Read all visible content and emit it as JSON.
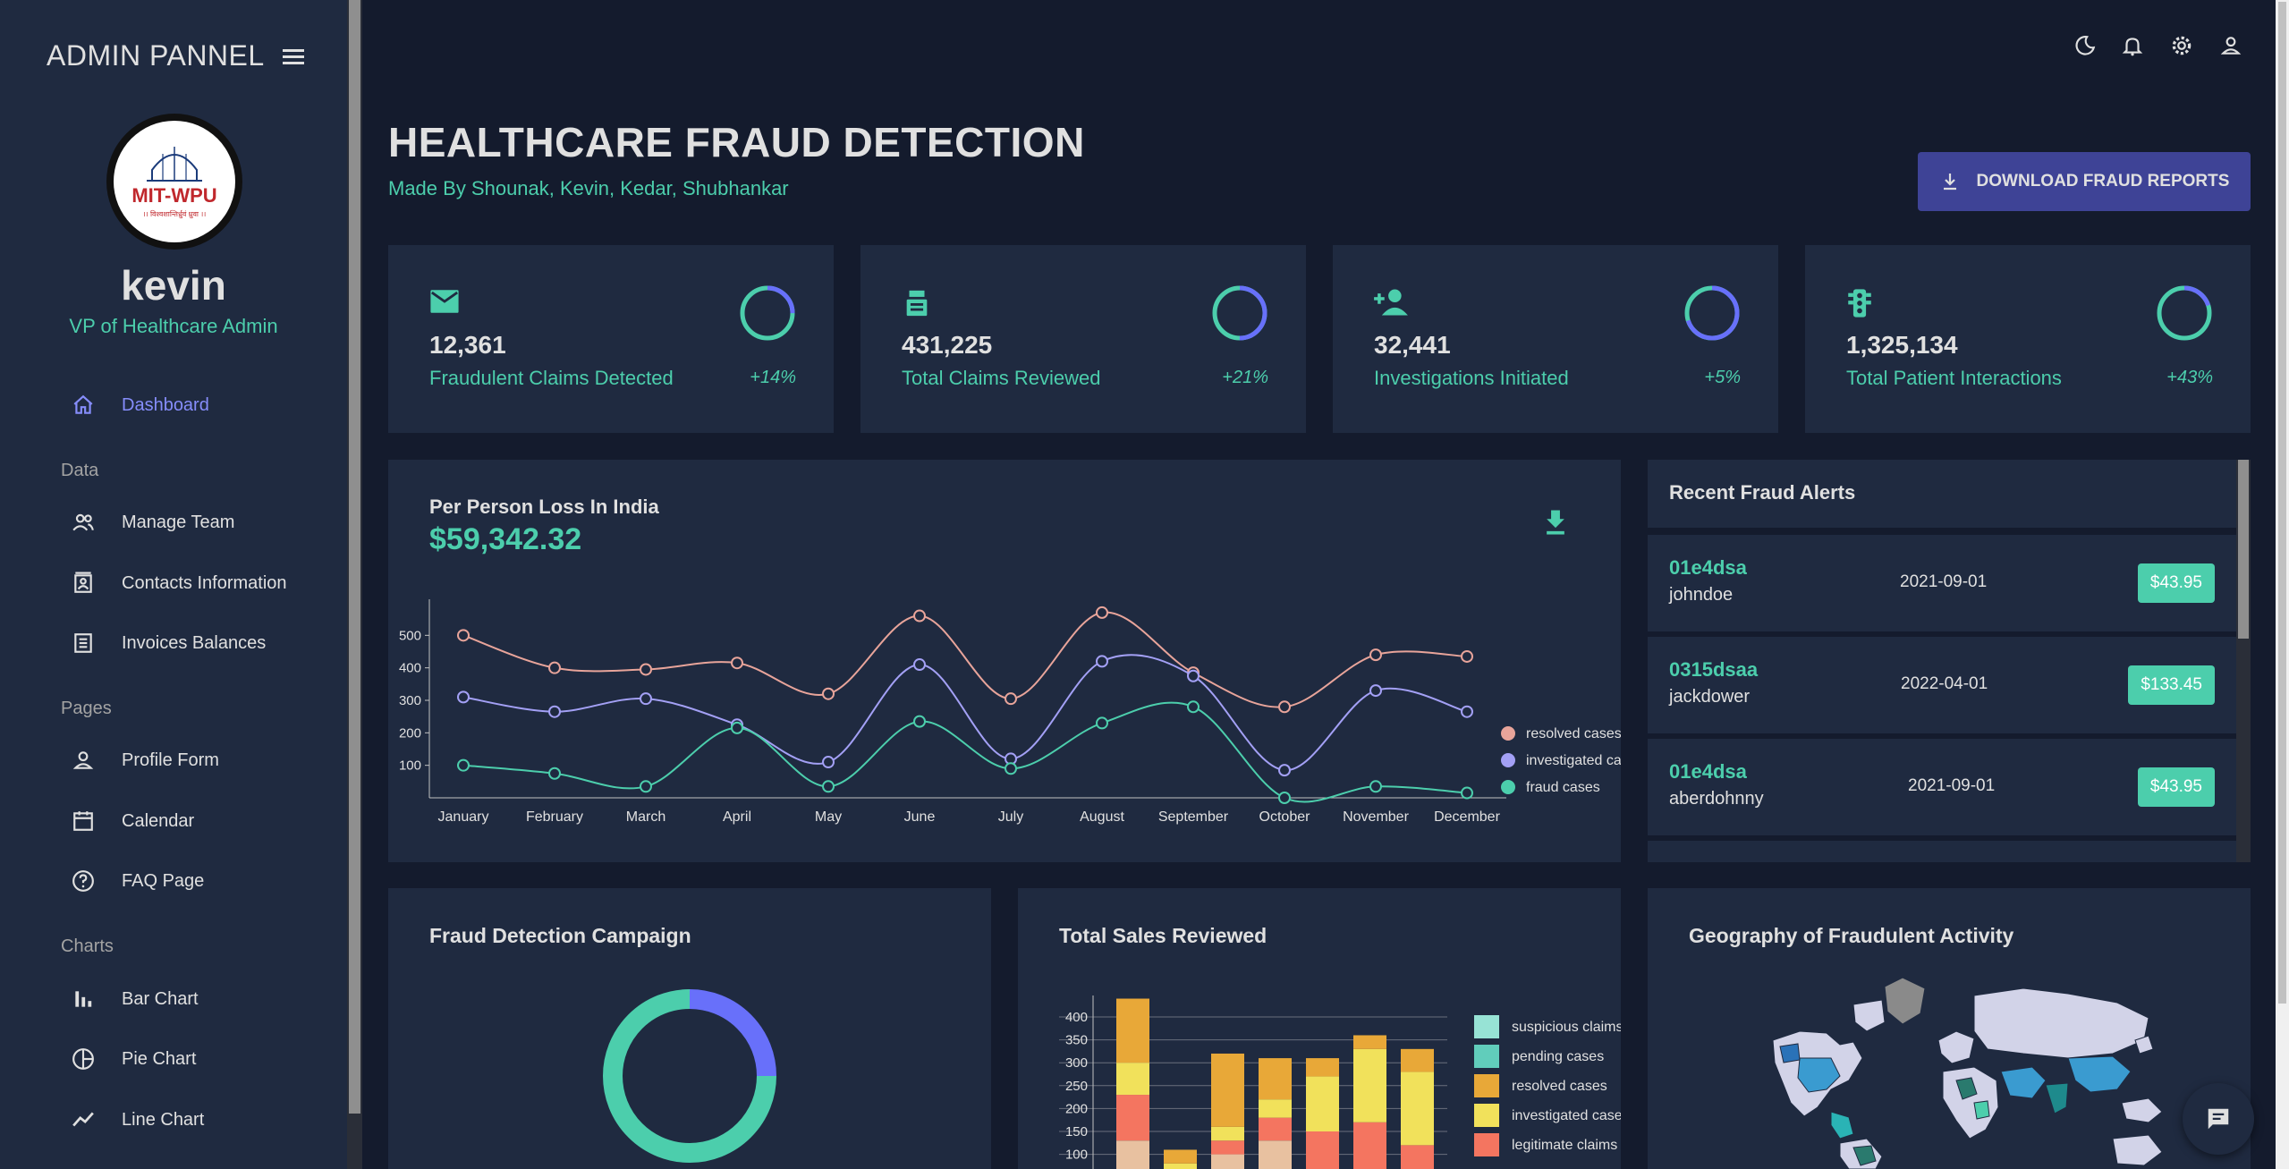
{
  "sidebar": {
    "title": "ADMIN PANNEL",
    "logo_text": "MIT-WPU",
    "logo_sub": "।। विश्वशान्तिर्ध्रुवं ध्रुवा ।।",
    "user_name": "kevin",
    "user_role": "VP of Healthcare Admin",
    "items": [
      {
        "label": "Dashboard",
        "icon": "home-icon"
      },
      {
        "label": "Manage Team",
        "icon": "people-icon"
      },
      {
        "label": "Contacts Information",
        "icon": "contacts-icon"
      },
      {
        "label": "Invoices Balances",
        "icon": "receipt-icon"
      },
      {
        "label": "Profile Form",
        "icon": "person-icon"
      },
      {
        "label": "Calendar",
        "icon": "calendar-icon"
      },
      {
        "label": "FAQ Page",
        "icon": "help-icon"
      },
      {
        "label": "Bar Chart",
        "icon": "bar-chart-icon"
      },
      {
        "label": "Pie Chart",
        "icon": "pie-chart-icon"
      },
      {
        "label": "Line Chart",
        "icon": "line-chart-icon"
      }
    ],
    "sections": [
      "Data",
      "Pages",
      "Charts"
    ]
  },
  "header": {
    "title": "HEALTHCARE FRAUD DETECTION",
    "subtitle": "Made By Shounak, Kevin, Kedar, Shubhankar",
    "download_label": "DOWNLOAD FRAUD REPORTS"
  },
  "stats": [
    {
      "value": "12,361",
      "label": "Fraudulent Claims Detected",
      "increase": "+14%",
      "progress": 0.75,
      "icon": "email-icon"
    },
    {
      "value": "431,225",
      "label": "Total Claims Reviewed",
      "increase": "+21%",
      "progress": 0.5,
      "icon": "point-of-sale-icon"
    },
    {
      "value": "32,441",
      "label": "Investigations Initiated",
      "increase": "+5%",
      "progress": 0.3,
      "icon": "person-add-icon"
    },
    {
      "value": "1,325,134",
      "label": "Total Patient Interactions",
      "increase": "+43%",
      "progress": 0.8,
      "icon": "traffic-icon"
    }
  ],
  "line_panel": {
    "title": "Per Person Loss In India",
    "value": "$59,342.32"
  },
  "alerts": {
    "title": "Recent Fraud Alerts",
    "rows": [
      {
        "txId": "01e4dsa",
        "user": "johndoe",
        "date": "2021-09-01",
        "cost": "$43.95"
      },
      {
        "txId": "0315dsaa",
        "user": "jackdower",
        "date": "2022-04-01",
        "cost": "$133.45"
      },
      {
        "txId": "01e4dsa",
        "user": "aberdohnny",
        "date": "2021-09-01",
        "cost": "$43.95"
      }
    ]
  },
  "panels": {
    "campaign_title": "Fraud Detection Campaign",
    "sales_title": "Total Sales Reviewed",
    "geo_title": "Geography of Fraudulent Activity"
  },
  "colors": {
    "accent": "#4cceac",
    "primary_btn": "#3e4396",
    "active_nav": "#868dfb",
    "card": "#1f2a40",
    "background": "#141b2d"
  },
  "chart_data": [
    {
      "type": "line",
      "x": [
        "January",
        "February",
        "March",
        "April",
        "May",
        "June",
        "July",
        "August",
        "September",
        "October",
        "November",
        "December"
      ],
      "ylim": [
        0,
        600
      ],
      "yticks": [
        100,
        200,
        300,
        400,
        500
      ],
      "series": [
        {
          "name": "resolved cases",
          "color": "#e8a49a",
          "values": [
            500,
            400,
            395,
            415,
            320,
            560,
            305,
            570,
            385,
            280,
            440,
            435
          ]
        },
        {
          "name": "investigated cases",
          "color": "#a3a0f5",
          "values": [
            310,
            265,
            305,
            225,
            110,
            410,
            120,
            420,
            375,
            85,
            330,
            265
          ]
        },
        {
          "name": "fraud cases",
          "color": "#4cceac",
          "values": [
            100,
            75,
            35,
            215,
            35,
            235,
            90,
            230,
            280,
            0,
            35,
            15
          ]
        }
      ],
      "legend": "right"
    },
    {
      "type": "pie",
      "values": [
        0.25,
        0.75
      ],
      "colors": [
        "#6870fa",
        "#4cceac"
      ]
    },
    {
      "type": "bar",
      "stacked": true,
      "yticks": [
        100,
        150,
        200,
        250,
        300,
        350,
        400
      ],
      "series": [
        {
          "name": "suspicious claims",
          "color": "#97e3d5"
        },
        {
          "name": "pending cases",
          "color": "#61cdbb"
        },
        {
          "name": "resolved cases",
          "color": "#e8a838"
        },
        {
          "name": "investigated cases",
          "color": "#f1e15b"
        },
        {
          "name": "legitimate claims",
          "color": "#f47560"
        }
      ],
      "bars": [
        [
          [
            "#e8c1a0",
            130
          ],
          [
            "#f47560",
            100
          ],
          [
            "#f1e15b",
            70
          ],
          [
            "#e8a838",
            140
          ]
        ],
        [
          [
            "#f47560",
            20
          ],
          [
            "#f1e15b",
            60
          ],
          [
            "#e8a838",
            30
          ]
        ],
        [
          [
            "#e8c1a0",
            100
          ],
          [
            "#f47560",
            30
          ],
          [
            "#f1e15b",
            30
          ],
          [
            "#e8a838",
            160
          ]
        ],
        [
          [
            "#e8c1a0",
            130
          ],
          [
            "#f47560",
            50
          ],
          [
            "#f1e15b",
            40
          ],
          [
            "#e8a838",
            90
          ]
        ],
        [
          [
            "#f47560",
            150
          ],
          [
            "#f1e15b",
            120
          ],
          [
            "#e8a838",
            40
          ]
        ],
        [
          [
            "#f47560",
            170
          ],
          [
            "#f1e15b",
            160
          ],
          [
            "#e8a838",
            30
          ]
        ],
        [
          [
            "#f47560",
            120
          ],
          [
            "#f1e15b",
            160
          ],
          [
            "#e8a838",
            50
          ]
        ]
      ],
      "legend": "right"
    }
  ]
}
